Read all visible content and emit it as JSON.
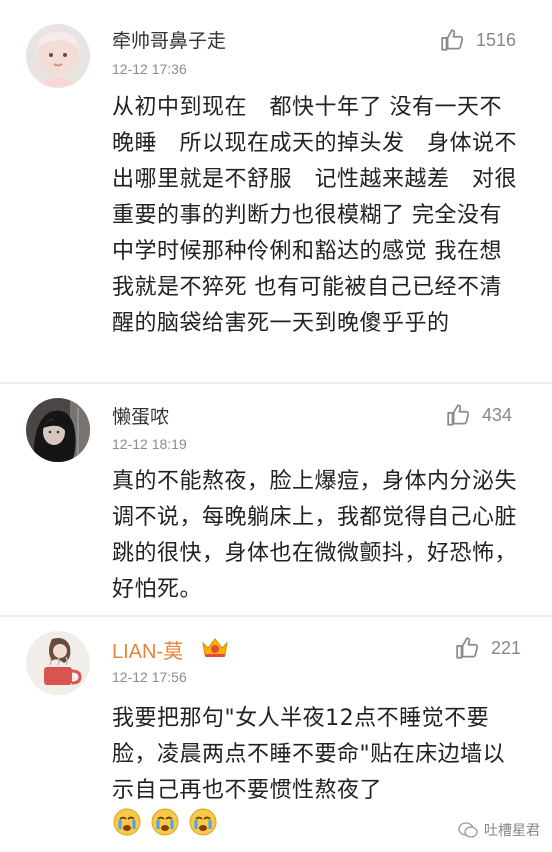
{
  "comments": [
    {
      "username": "牵帅哥鼻子走",
      "time": "12-12 17:36",
      "likes": "1516",
      "text": "从初中到现在　都快十年了 没有一天不晚睡　所以现在成天的掉头发　身体说不出哪里就是不舒服　记性越来越差　对很重要的事的判断力也很模糊了 完全没有中学时候那种伶俐和豁达的感觉 我在想我就是不猝死 也有可能被自己已经不清醒的脑袋给害死一天到晚傻乎乎的"
    },
    {
      "username": "懒蛋哝",
      "time": "12-12 18:19",
      "likes": "434",
      "text": "真的不能熬夜，脸上爆痘，身体内分泌失调不说，每晚躺床上，我都觉得自己心脏跳的很快，身体也在微微颤抖，好恐怖，好怕死。"
    },
    {
      "username": "LIAN-莫",
      "time": "12-12 17:56",
      "likes": "221",
      "text": "我要把那句\"女人半夜12点不睡觉不要脸，凌晨两点不睡不要命\"贴在床边墙以示自己再也不要惯性熬夜了",
      "emojis": [
        "crying-face",
        "crying-face",
        "crying-face"
      ]
    }
  ],
  "watermark": "吐槽星君",
  "colors": {
    "username": "#333333",
    "username_vip": "#e8833a",
    "meta": "#8c8c8c",
    "text": "#222222",
    "separator": "#eeeeee"
  }
}
